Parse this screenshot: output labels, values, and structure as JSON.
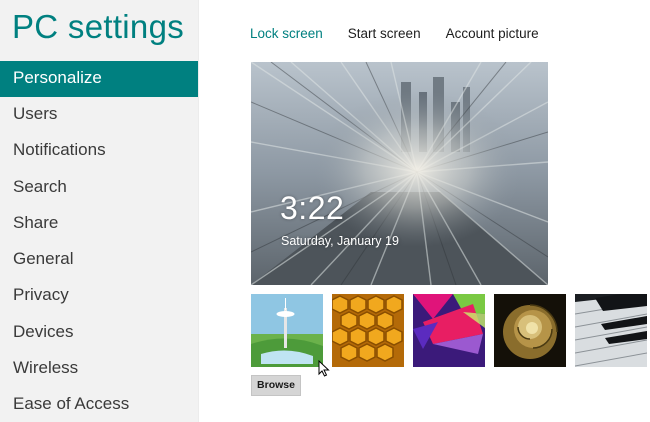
{
  "app": {
    "title": "PC settings"
  },
  "sidebar": {
    "items": [
      {
        "label": "Personalize",
        "selected": true
      },
      {
        "label": "Users"
      },
      {
        "label": "Notifications"
      },
      {
        "label": "Search"
      },
      {
        "label": "Share"
      },
      {
        "label": "General"
      },
      {
        "label": "Privacy"
      },
      {
        "label": "Devices"
      },
      {
        "label": "Wireless"
      },
      {
        "label": "Ease of Access"
      }
    ]
  },
  "tabs": [
    {
      "label": "Lock screen",
      "active": true
    },
    {
      "label": "Start screen"
    },
    {
      "label": "Account picture"
    }
  ],
  "lock_screen": {
    "time": "3:22",
    "date": "Saturday, January 19"
  },
  "thumbnails": [
    {
      "icon": "space-needle-icon"
    },
    {
      "icon": "honeycomb-icon"
    },
    {
      "icon": "geometric-shapes-icon"
    },
    {
      "icon": "nautilus-shell-icon"
    },
    {
      "icon": "piano-keys-icon"
    }
  ],
  "browse": {
    "label": "Browse"
  },
  "colors": {
    "accent": "#008080",
    "sidebar_bg": "#f2f2f2",
    "button_bg": "#d5d5d5"
  }
}
